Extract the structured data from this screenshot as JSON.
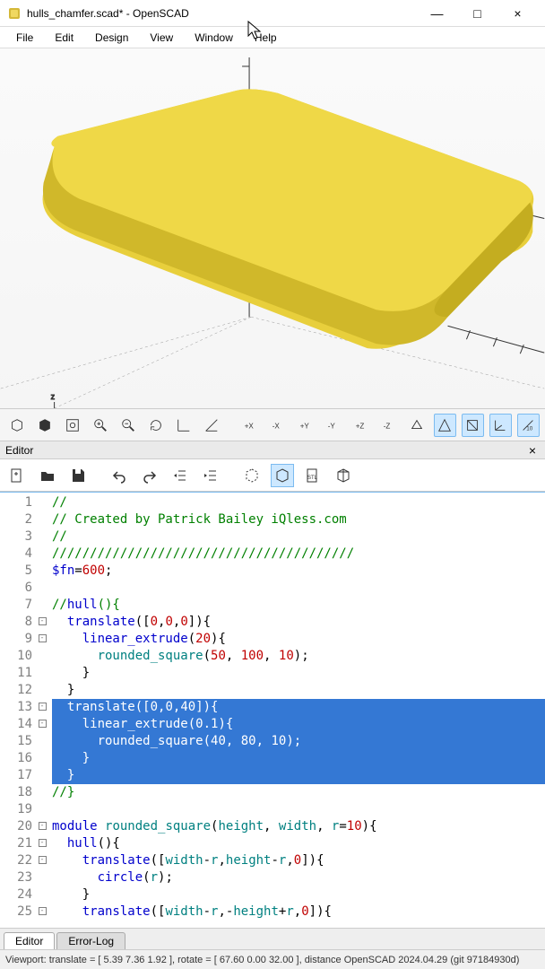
{
  "window": {
    "title": "hulls_chamfer.scad* - OpenSCAD",
    "minimize": "—",
    "maximize": "□",
    "close": "×"
  },
  "menu": {
    "items": [
      "File",
      "Edit",
      "Design",
      "View",
      "Window",
      "Help"
    ]
  },
  "view_toolbar": {
    "items": [
      "preview",
      "render",
      "view-all",
      "zoom-in",
      "zoom-out",
      "reset-view",
      "show-axes",
      "show-edges",
      "unknown",
      "right",
      "front",
      "top",
      "back",
      "left",
      "bottom",
      "diagonal",
      "perspective",
      "orthogonal",
      "wireframe",
      "show-scale"
    ]
  },
  "editor": {
    "header": "Editor",
    "toolbar": [
      "new",
      "open",
      "save",
      "undo",
      "redo",
      "unindent",
      "indent",
      "preview",
      "render",
      "export-stl",
      "export-3d"
    ]
  },
  "code": {
    "lines": [
      {
        "n": 1,
        "t": "//"
      },
      {
        "n": 2,
        "t": "// Created by Patrick Bailey iQless.com"
      },
      {
        "n": 3,
        "t": "//"
      },
      {
        "n": 4,
        "t": "////////////////////////////////////////"
      },
      {
        "n": 5,
        "t": "$fn=600;"
      },
      {
        "n": 6,
        "t": ""
      },
      {
        "n": 7,
        "t": "//hull(){"
      },
      {
        "n": 8,
        "t": "  translate([0,0,0]){"
      },
      {
        "n": 9,
        "t": "    linear_extrude(20){"
      },
      {
        "n": 10,
        "t": "      rounded_square(50, 100, 10);"
      },
      {
        "n": 11,
        "t": "    }"
      },
      {
        "n": 12,
        "t": "  }"
      },
      {
        "n": 13,
        "t": "  translate([0,0,40]){"
      },
      {
        "n": 14,
        "t": "    linear_extrude(0.1){"
      },
      {
        "n": 15,
        "t": "      rounded_square(40, 80, 10);"
      },
      {
        "n": 16,
        "t": "    }"
      },
      {
        "n": 17,
        "t": "  }"
      },
      {
        "n": 18,
        "t": "//}"
      },
      {
        "n": 19,
        "t": ""
      },
      {
        "n": 20,
        "t": "module rounded_square(height, width, r=10){"
      },
      {
        "n": 21,
        "t": "  hull(){"
      },
      {
        "n": 22,
        "t": "    translate([width-r,height-r,0]){"
      },
      {
        "n": 23,
        "t": "      circle(r);"
      },
      {
        "n": 24,
        "t": "    }"
      },
      {
        "n": 25,
        "t": "    translate([width-r,-height+r,0]){"
      }
    ]
  },
  "tabs": {
    "active": "Editor",
    "inactive": "Error-Log"
  },
  "status": "Viewport: translate = [ 5.39 7.36 1.92 ], rotate = [ 67.60 0.00 32.00 ], distance OpenSCAD 2024.04.29 (git 97184930d)"
}
